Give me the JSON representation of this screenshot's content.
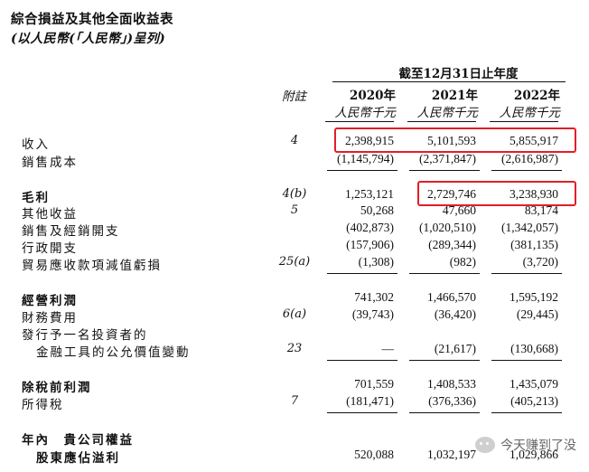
{
  "title": "綜合損益及其他全面收益表",
  "subtitle": "(以人民幣(「人民幣」)呈列)",
  "period_header": "截至12月31日止年度",
  "note_header": "附註",
  "years": [
    "2020年",
    "2021年",
    "2022年"
  ],
  "unit": "人民幣千元",
  "rows": [
    {
      "label": "收入",
      "note": "4",
      "values": [
        "2,398,915",
        "5,101,593",
        "5,855,917"
      ]
    },
    {
      "label": "銷售成本",
      "note": "",
      "values": [
        "(1,145,794)",
        "(2,371,847)",
        "(2,616,987)"
      ]
    },
    {
      "label": "毛利",
      "note": "4(b)",
      "values": [
        "1,253,121",
        "2,729,746",
        "3,238,930"
      ]
    },
    {
      "label": "其他收益",
      "note": "5",
      "values": [
        "50,268",
        "47,660",
        "83,174"
      ]
    },
    {
      "label": "銷售及經銷開支",
      "note": "",
      "values": [
        "(402,873)",
        "(1,020,510)",
        "(1,342,057)"
      ]
    },
    {
      "label": "行政開支",
      "note": "",
      "values": [
        "(157,906)",
        "(289,344)",
        "(381,135)"
      ]
    },
    {
      "label": "貿易應收款項減值虧損",
      "note": "25(a)",
      "values": [
        "(1,308)",
        "(982)",
        "(3,720)"
      ]
    },
    {
      "label": "經營利潤",
      "note": "",
      "values": [
        "741,302",
        "1,466,570",
        "1,595,192"
      ]
    },
    {
      "label": "財務費用",
      "note": "6(a)",
      "values": [
        "(39,743)",
        "(36,420)",
        "(29,445)"
      ]
    },
    {
      "label": "發行予一名投資者的",
      "note": "",
      "values": [
        "",
        "",
        ""
      ]
    },
    {
      "label": "金融工具的公允價值變動",
      "note": "23",
      "values": [
        "—",
        "(21,617)",
        "(130,668)"
      ]
    },
    {
      "label": "除稅前利潤",
      "note": "",
      "values": [
        "701,559",
        "1,408,533",
        "1,435,079"
      ]
    },
    {
      "label": "所得稅",
      "note": "7",
      "values": [
        "(181,471)",
        "(376,336)",
        "(405,213)"
      ]
    },
    {
      "label": "年內　貴公司權益",
      "note": "",
      "values": [
        "",
        "",
        ""
      ]
    },
    {
      "label": "股東應佔溢利",
      "note": "",
      "values": [
        "520,088",
        "1,032,197",
        "1,029,866"
      ]
    }
  ],
  "watermark": "今天赚到了没",
  "highlight_color": "#e01f26"
}
